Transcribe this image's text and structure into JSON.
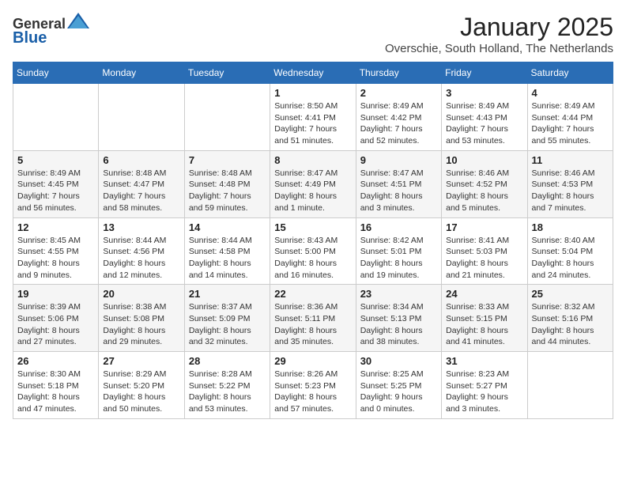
{
  "logo": {
    "general": "General",
    "blue": "Blue"
  },
  "header": {
    "month": "January 2025",
    "location": "Overschie, South Holland, The Netherlands"
  },
  "weekdays": [
    "Sunday",
    "Monday",
    "Tuesday",
    "Wednesday",
    "Thursday",
    "Friday",
    "Saturday"
  ],
  "weeks": [
    [
      {
        "day": "",
        "info": ""
      },
      {
        "day": "",
        "info": ""
      },
      {
        "day": "",
        "info": ""
      },
      {
        "day": "1",
        "info": "Sunrise: 8:50 AM\nSunset: 4:41 PM\nDaylight: 7 hours and 51 minutes."
      },
      {
        "day": "2",
        "info": "Sunrise: 8:49 AM\nSunset: 4:42 PM\nDaylight: 7 hours and 52 minutes."
      },
      {
        "day": "3",
        "info": "Sunrise: 8:49 AM\nSunset: 4:43 PM\nDaylight: 7 hours and 53 minutes."
      },
      {
        "day": "4",
        "info": "Sunrise: 8:49 AM\nSunset: 4:44 PM\nDaylight: 7 hours and 55 minutes."
      }
    ],
    [
      {
        "day": "5",
        "info": "Sunrise: 8:49 AM\nSunset: 4:45 PM\nDaylight: 7 hours and 56 minutes."
      },
      {
        "day": "6",
        "info": "Sunrise: 8:48 AM\nSunset: 4:47 PM\nDaylight: 7 hours and 58 minutes."
      },
      {
        "day": "7",
        "info": "Sunrise: 8:48 AM\nSunset: 4:48 PM\nDaylight: 7 hours and 59 minutes."
      },
      {
        "day": "8",
        "info": "Sunrise: 8:47 AM\nSunset: 4:49 PM\nDaylight: 8 hours and 1 minute."
      },
      {
        "day": "9",
        "info": "Sunrise: 8:47 AM\nSunset: 4:51 PM\nDaylight: 8 hours and 3 minutes."
      },
      {
        "day": "10",
        "info": "Sunrise: 8:46 AM\nSunset: 4:52 PM\nDaylight: 8 hours and 5 minutes."
      },
      {
        "day": "11",
        "info": "Sunrise: 8:46 AM\nSunset: 4:53 PM\nDaylight: 8 hours and 7 minutes."
      }
    ],
    [
      {
        "day": "12",
        "info": "Sunrise: 8:45 AM\nSunset: 4:55 PM\nDaylight: 8 hours and 9 minutes."
      },
      {
        "day": "13",
        "info": "Sunrise: 8:44 AM\nSunset: 4:56 PM\nDaylight: 8 hours and 12 minutes."
      },
      {
        "day": "14",
        "info": "Sunrise: 8:44 AM\nSunset: 4:58 PM\nDaylight: 8 hours and 14 minutes."
      },
      {
        "day": "15",
        "info": "Sunrise: 8:43 AM\nSunset: 5:00 PM\nDaylight: 8 hours and 16 minutes."
      },
      {
        "day": "16",
        "info": "Sunrise: 8:42 AM\nSunset: 5:01 PM\nDaylight: 8 hours and 19 minutes."
      },
      {
        "day": "17",
        "info": "Sunrise: 8:41 AM\nSunset: 5:03 PM\nDaylight: 8 hours and 21 minutes."
      },
      {
        "day": "18",
        "info": "Sunrise: 8:40 AM\nSunset: 5:04 PM\nDaylight: 8 hours and 24 minutes."
      }
    ],
    [
      {
        "day": "19",
        "info": "Sunrise: 8:39 AM\nSunset: 5:06 PM\nDaylight: 8 hours and 27 minutes."
      },
      {
        "day": "20",
        "info": "Sunrise: 8:38 AM\nSunset: 5:08 PM\nDaylight: 8 hours and 29 minutes."
      },
      {
        "day": "21",
        "info": "Sunrise: 8:37 AM\nSunset: 5:09 PM\nDaylight: 8 hours and 32 minutes."
      },
      {
        "day": "22",
        "info": "Sunrise: 8:36 AM\nSunset: 5:11 PM\nDaylight: 8 hours and 35 minutes."
      },
      {
        "day": "23",
        "info": "Sunrise: 8:34 AM\nSunset: 5:13 PM\nDaylight: 8 hours and 38 minutes."
      },
      {
        "day": "24",
        "info": "Sunrise: 8:33 AM\nSunset: 5:15 PM\nDaylight: 8 hours and 41 minutes."
      },
      {
        "day": "25",
        "info": "Sunrise: 8:32 AM\nSunset: 5:16 PM\nDaylight: 8 hours and 44 minutes."
      }
    ],
    [
      {
        "day": "26",
        "info": "Sunrise: 8:30 AM\nSunset: 5:18 PM\nDaylight: 8 hours and 47 minutes."
      },
      {
        "day": "27",
        "info": "Sunrise: 8:29 AM\nSunset: 5:20 PM\nDaylight: 8 hours and 50 minutes."
      },
      {
        "day": "28",
        "info": "Sunrise: 8:28 AM\nSunset: 5:22 PM\nDaylight: 8 hours and 53 minutes."
      },
      {
        "day": "29",
        "info": "Sunrise: 8:26 AM\nSunset: 5:23 PM\nDaylight: 8 hours and 57 minutes."
      },
      {
        "day": "30",
        "info": "Sunrise: 8:25 AM\nSunset: 5:25 PM\nDaylight: 9 hours and 0 minutes."
      },
      {
        "day": "31",
        "info": "Sunrise: 8:23 AM\nSunset: 5:27 PM\nDaylight: 9 hours and 3 minutes."
      },
      {
        "day": "",
        "info": ""
      }
    ]
  ]
}
